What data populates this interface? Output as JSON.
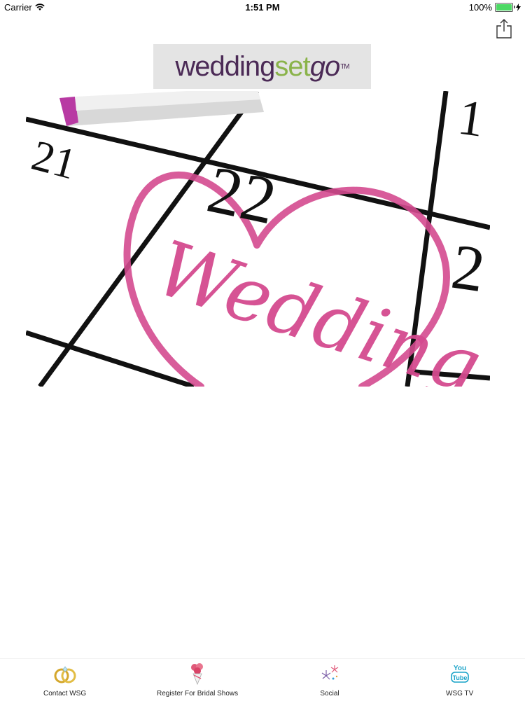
{
  "status_bar": {
    "carrier": "Carrier",
    "time": "1:51 PM",
    "battery": "100%"
  },
  "logo": {
    "part1": "wedding",
    "part2": "set",
    "part3": "go",
    "tm": "TM"
  },
  "banner": {
    "numbers": [
      "21",
      "22",
      "1",
      "2"
    ],
    "script_text": "Wedding"
  },
  "colors": {
    "logo_purple": "#4b2a56",
    "logo_green": "#8ab34a",
    "heart_pink": "#d44a8f"
  },
  "tabs": [
    {
      "label": "Contact WSG",
      "icon": "rings-icon"
    },
    {
      "label": "Register For Bridal Shows",
      "icon": "bouquet-icon"
    },
    {
      "label": "Social",
      "icon": "fireworks-icon"
    },
    {
      "label": "WSG TV",
      "icon": "youtube-icon"
    }
  ]
}
